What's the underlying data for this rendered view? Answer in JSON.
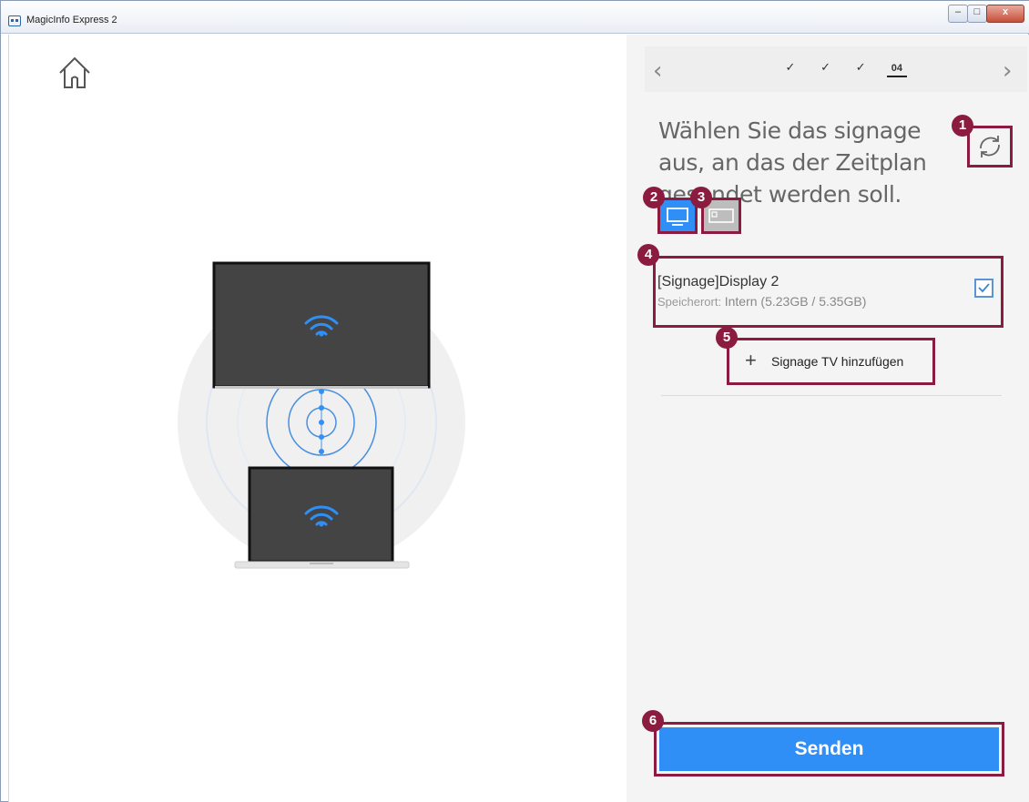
{
  "window": {
    "title": "MagicInfo Express 2",
    "controls": {
      "minimize": "–",
      "maximize": "□",
      "close": "x"
    }
  },
  "nav": {
    "prev_icon": "chevron-left",
    "next_icon": "chevron-right",
    "steps": [
      "✓",
      "✓",
      "✓"
    ],
    "current_step": "04"
  },
  "heading": "Wählen Sie das signage aus, an das der Zeitplan gesendet werden soll.",
  "display_types": [
    {
      "name": "Signage",
      "icon": "monitor-icon",
      "active": true
    },
    {
      "name": "Videowall",
      "icon": "videowall-icon",
      "active": false
    }
  ],
  "device": {
    "name": "[Signage]Display 2",
    "location_label": "Speicherort:",
    "location_value": "Intern (5.23GB / 5.35GB)",
    "checked": true
  },
  "add_button": {
    "label": "Signage TV hinzufügen"
  },
  "send_button": {
    "label": "Senden"
  },
  "badges": [
    "1",
    "2",
    "3",
    "4",
    "5",
    "6"
  ],
  "colors": {
    "accent": "#2f8ff7",
    "annotation": "#8b1b3f",
    "panel": "#f4f4f4"
  }
}
